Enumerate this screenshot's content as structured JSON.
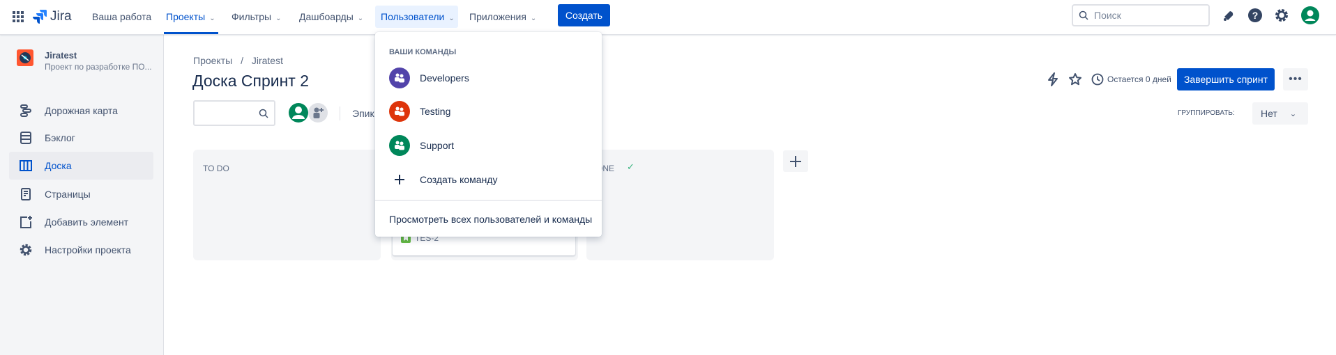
{
  "nav": {
    "product": "Jira",
    "items": [
      {
        "label": "Ваша работа",
        "chevron": false
      },
      {
        "label": "Проекты",
        "chevron": true
      },
      {
        "label": "Фильтры",
        "chevron": true
      },
      {
        "label": "Дашбоарды",
        "chevron": true
      },
      {
        "label": "Пользователи",
        "chevron": true
      },
      {
        "label": "Приложения",
        "chevron": true
      }
    ],
    "create_label": "Создать",
    "search_placeholder": "Поиск",
    "active_item": "Проекты",
    "open_item": "Пользователи"
  },
  "sidebar": {
    "project_name": "Jiratest",
    "project_desc": "Проект по разработке ПО...",
    "items": [
      {
        "label": "Дорожная карта",
        "icon": "roadmap-icon"
      },
      {
        "label": "Бэклог",
        "icon": "backlog-icon"
      },
      {
        "label": "Доска",
        "icon": "board-icon",
        "selected": true
      },
      {
        "label": "Страницы",
        "icon": "pages-icon"
      },
      {
        "label": "Добавить элемент",
        "icon": "add-item-icon"
      },
      {
        "label": "Настройки проекта",
        "icon": "gear-icon"
      }
    ]
  },
  "main": {
    "breadcrumb": [
      "Проекты",
      "Jiratest"
    ],
    "title": "Доска Спринт 2",
    "epic_filter": "Эпик",
    "days_left": "Остается 0 дней",
    "complete_sprint": "Завершить спринт",
    "group_label": "ГРУППИРОВАТЬ:",
    "group_value": "Нет",
    "columns": [
      {
        "title": "TO DO"
      },
      {
        "title": "",
        "cards": [
          {
            "key": "TES-2"
          }
        ]
      },
      {
        "title": "ONE"
      }
    ]
  },
  "dropdown": {
    "header": "ВАШИ КОМАНДЫ",
    "teams": [
      {
        "name": "Developers",
        "color": "#5243aa"
      },
      {
        "name": "Testing",
        "color": "#de350b"
      },
      {
        "name": "Support",
        "color": "#00875a"
      }
    ],
    "create_team": "Создать команду",
    "view_all": "Просмотреть всех пользователей и команды"
  },
  "colors": {
    "accent": "#0052cc",
    "sidebar_bg": "#f4f5f7",
    "avatar": "#00875a"
  }
}
